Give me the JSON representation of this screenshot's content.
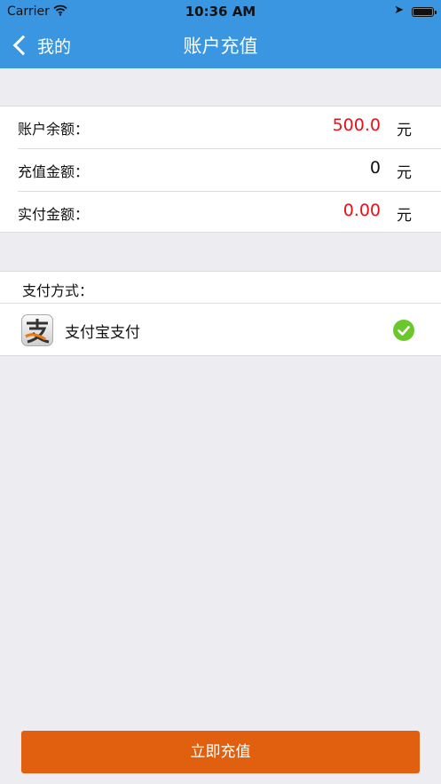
{
  "status_bar": {
    "carrier": "Carrier",
    "time": "10:36 AM",
    "icons": [
      "wifi-icon",
      "location-arrow-icon",
      "battery-icon"
    ]
  },
  "nav": {
    "back_label": "我的",
    "title": "账户充值",
    "background_color": "#3a96e0"
  },
  "account": {
    "rows": [
      {
        "label": "账户余额：",
        "value": "500.0",
        "unit": "元",
        "value_color": "#e8101c"
      },
      {
        "label": "充值金额：",
        "value": "0",
        "unit": "元",
        "value_color": "#111111"
      },
      {
        "label": "实付金额：",
        "value": "0.00",
        "unit": "元",
        "value_color": "#e8101c"
      }
    ]
  },
  "payment": {
    "title": "支付方式：",
    "method": {
      "name": "支付宝支付",
      "icon": "alipay-icon",
      "selected": true
    }
  },
  "submit_label": "立即充值",
  "accent_color": "#e0600f"
}
